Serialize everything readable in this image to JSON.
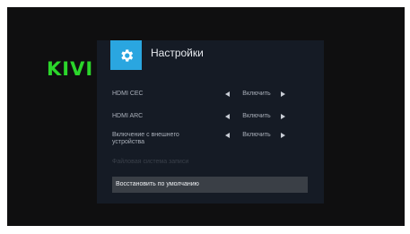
{
  "brand": {
    "logo_text": "KIVI",
    "logo_color": "#2bd62b"
  },
  "panel": {
    "title": "Настройки",
    "icon": "gear-icon",
    "accent": "#2aa6e0"
  },
  "settings": [
    {
      "label": "HDMI CEC",
      "value": "Включить"
    },
    {
      "label": "HDMI ARC",
      "value": "Включить"
    },
    {
      "label": "Включение с внешнего устройства",
      "value": "Включить"
    }
  ],
  "disabled_item": {
    "label": "Файловая система записи"
  },
  "reset": {
    "label": "Восстановить по умолчанию"
  }
}
